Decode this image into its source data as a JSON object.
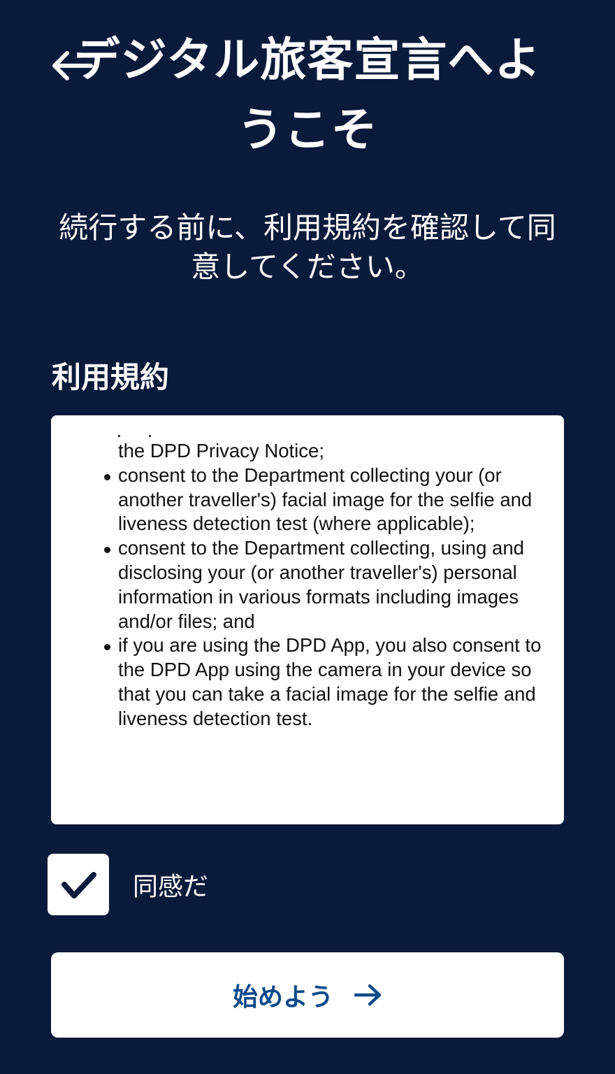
{
  "header": {
    "back_icon": "arrow-left-icon",
    "title": "デジタル旅客宣言へようこそ"
  },
  "intro": {
    "subtitle": "続行する前に、利用規約を確認して同意してください。"
  },
  "terms": {
    "heading": "利用規約",
    "cut_line": "the DPD Privacy Notice;",
    "items": [
      "consent to the Department collecting your (or another traveller's) facial image for the selfie and liveness detection test (where applicable);",
      "consent to the Department collecting, using and disclosing your (or another traveller's) personal information in various formats including images and/or files; and",
      "if you are using the DPD App, you also consent to the DPD App using the camera in your device so that you can take a facial image for the selfie and liveness detection test."
    ]
  },
  "agree": {
    "checked": true,
    "label": "同感だ",
    "icon": "checkmark-icon"
  },
  "start_button": {
    "label": "始めよう",
    "icon": "arrow-right-icon"
  },
  "colors": {
    "background": "#0a1a3a",
    "button_text": "#0b4a8b",
    "surface": "#ffffff"
  }
}
